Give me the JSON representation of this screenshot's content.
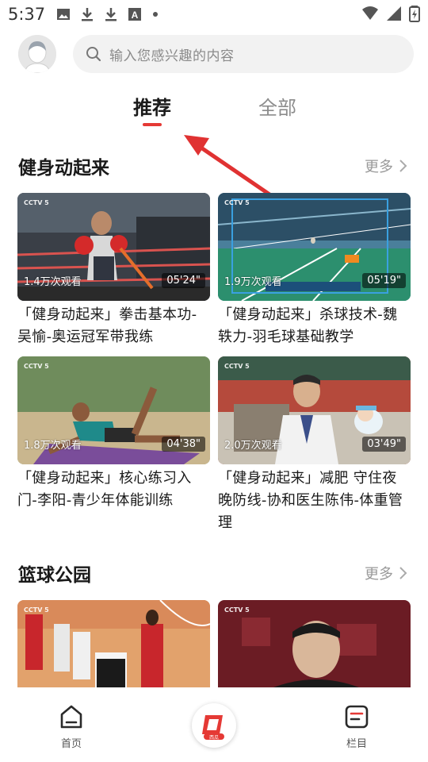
{
  "status_bar": {
    "time": "5:37"
  },
  "search": {
    "placeholder": "输入您感兴趣的内容"
  },
  "tabs": [
    {
      "label": "推荐",
      "active": true
    },
    {
      "label": "全部",
      "active": false
    }
  ],
  "sections": [
    {
      "title": "健身动起来",
      "more_label": "更多",
      "cards": [
        {
          "title": "「健身动起来」拳击基本功-吴愉-奥运冠军带我练",
          "views": "1.4万次观看",
          "duration": "05'24\""
        },
        {
          "title": "「健身动起来」杀球技术-魏轶力-羽毛球基础教学",
          "views": "1.9万次观看",
          "duration": "05'19\""
        },
        {
          "title": "「健身动起来」核心练习入门-李阳-青少年体能训练",
          "views": "1.8万次观看",
          "duration": "04'38\""
        },
        {
          "title": "「健身动起来」减肥 守住夜晚防线-协和医生陈伟-体重管理",
          "views": "2.0万次观看",
          "duration": "03'49\""
        }
      ]
    },
    {
      "title": "篮球公园",
      "more_label": "更多",
      "cards": []
    }
  ],
  "bottom_nav": {
    "home_label": "首页",
    "center_label": "西瓜",
    "columns_label": "栏目"
  },
  "colors": {
    "accent": "#e53935"
  }
}
